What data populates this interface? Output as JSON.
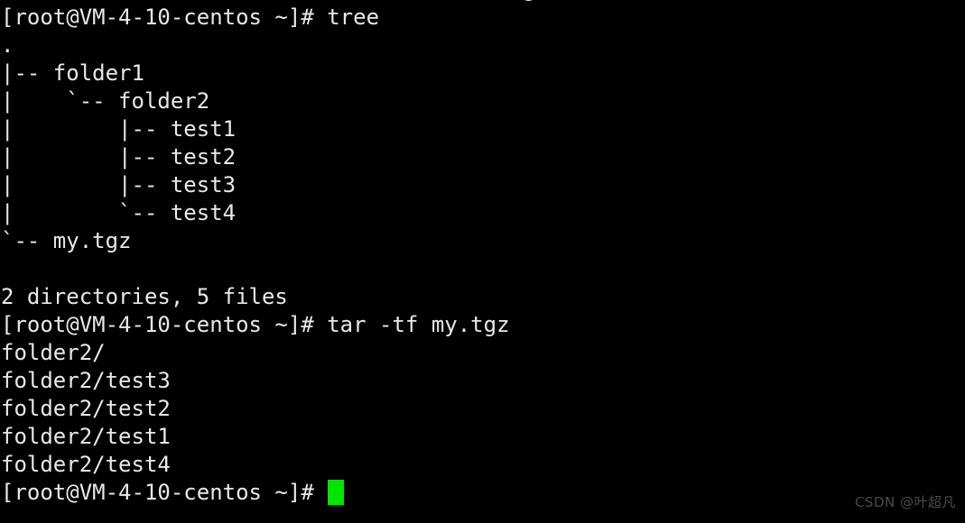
{
  "terminal": {
    "background_color": "#000000",
    "text_color": "#e8e8e8",
    "cursor_color": "#00e500",
    "prompt": "[root@VM-4-10-centos ~]#",
    "lines": [
      {
        "id": "scrollback-partial",
        "text": "                                        g"
      },
      {
        "id": "prompt-tree",
        "text": "[root@VM-4-10-centos ~]# tree"
      },
      {
        "id": "tree-root",
        "text": "."
      },
      {
        "id": "tree-folder1",
        "text": "|-- folder1"
      },
      {
        "id": "tree-folder2",
        "text": "|    `-- folder2"
      },
      {
        "id": "tree-test1",
        "text": "|        |-- test1"
      },
      {
        "id": "tree-test2",
        "text": "|        |-- test2"
      },
      {
        "id": "tree-test3",
        "text": "|        |-- test3"
      },
      {
        "id": "tree-test4",
        "text": "|        `-- test4"
      },
      {
        "id": "tree-mytgz",
        "text": "`-- my.tgz"
      },
      {
        "id": "tree-spacer",
        "text": ""
      },
      {
        "id": "tree-summary",
        "text": "2 directories, 5 files"
      },
      {
        "id": "prompt-tar",
        "text": "[root@VM-4-10-centos ~]# tar -tf my.tgz"
      },
      {
        "id": "tar-out-folder2",
        "text": "folder2/"
      },
      {
        "id": "tar-out-test3",
        "text": "folder2/test3"
      },
      {
        "id": "tar-out-test2",
        "text": "folder2/test2"
      },
      {
        "id": "tar-out-test1",
        "text": "folder2/test1"
      },
      {
        "id": "tar-out-test4",
        "text": "folder2/test4"
      }
    ],
    "current_prompt": "[root@VM-4-10-centos ~]# ",
    "commands": {
      "tree": "tree",
      "tar_list": "tar -tf my.tgz"
    },
    "summary": {
      "directories": "2",
      "files": "5"
    }
  },
  "watermark": {
    "text": "CSDN @叶超凡"
  }
}
